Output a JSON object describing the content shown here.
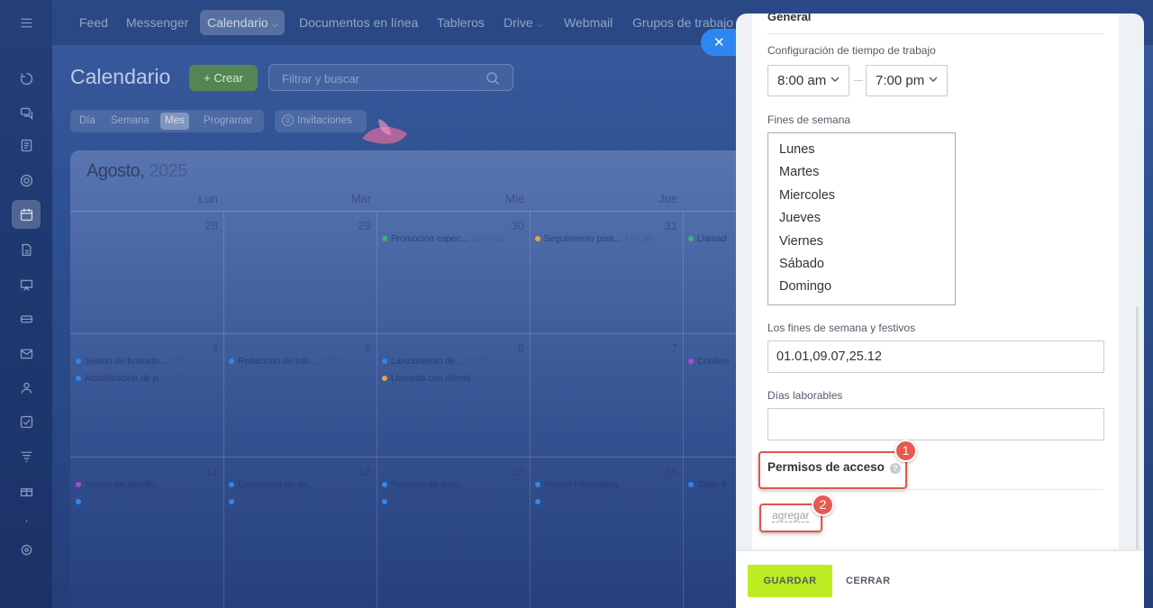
{
  "rail": {
    "icons": [
      "menu-icon",
      "sync-icon",
      "chat-icon",
      "doc-list-icon",
      "target-icon",
      "calendar-icon",
      "document-icon",
      "board-icon",
      "drive-icon",
      "mail-icon",
      "contacts-icon",
      "tasks-icon",
      "filter-icon",
      "gifts-icon",
      "more-icon",
      "settings-icon"
    ]
  },
  "topnav": {
    "items": [
      "Feed",
      "Messenger",
      "Calendario",
      "Documentos en línea",
      "Tableros",
      "Drive",
      "Webmail",
      "Grupos de trabajo"
    ],
    "active": "Calendario"
  },
  "calendar": {
    "title": "Calendario",
    "create_label": "+ Crear",
    "search_placeholder": "Filtrar y buscar",
    "views": [
      "Día",
      "Semana",
      "Mes",
      "Programar"
    ],
    "active_view": "Mes",
    "invitations_count": "0",
    "invitations_label": "Invitaciones",
    "month": "Agosto,",
    "year": "2025",
    "weekdays": [
      "Lun",
      "Mar",
      "Mié",
      "Jue"
    ],
    "weeks": [
      {
        "days": [
          "28",
          "29",
          "30",
          "31"
        ],
        "events": [
          {
            "col": 2,
            "row": 0,
            "title": "Promoción espec...",
            "time": "10:00 am",
            "color": "#3bb273"
          },
          {
            "col": 3,
            "row": 0,
            "title": "Seguimiento post...",
            "time": "4:00 pm",
            "color": "#e6a23c"
          },
          {
            "col": 4,
            "row": 0,
            "title": "Llamad",
            "time": "",
            "color": "#3bb273"
          }
        ]
      },
      {
        "days": [
          "4",
          "5",
          "6",
          "7"
        ],
        "events": [
          {
            "col": 0,
            "row": 0,
            "title": "Sesión de brainsto...",
            "time": "1:30 pm",
            "color": "#2f86f0"
          },
          {
            "col": 0,
            "row": 1,
            "title": "Actualización de p...",
            "time": "3:00 pm",
            "color": "#2f86f0"
          },
          {
            "col": 1,
            "row": 0,
            "title": "Redacción de info...",
            "time": "2:00 pm",
            "color": "#2f86f0"
          },
          {
            "col": 2,
            "row": 0,
            "title": "Lanzamiento de ...",
            "time": "10:30 am",
            "color": "#2f86f0"
          },
          {
            "col": 2,
            "row": 1,
            "title": "Llamada con cliente",
            "time": "2:00 pm",
            "color": "#e6a23c"
          },
          {
            "col": 4,
            "row": 0,
            "title": "Confere",
            "time": "",
            "color": "#a84bd6"
          }
        ]
      },
      {
        "days": [
          "11",
          "12",
          "13",
          "14"
        ],
        "events": [
          {
            "col": 0,
            "row": 0,
            "title": "Sesión de planific...",
            "time": "3:00 pm",
            "color": "#a84bd6"
          },
          {
            "col": 0,
            "row": 1,
            "title": "Sesión informativa",
            "time": "10:30 pm",
            "color": "#2f86f0",
            "faded": true
          },
          {
            "col": 1,
            "row": 0,
            "title": "Evaluación de de...",
            "time": "11:00 am",
            "color": "#2f86f0"
          },
          {
            "col": 1,
            "row": 1,
            "title": "Evento de networ...",
            "time": "1:30 pm",
            "color": "#2f86f0",
            "faded": true
          },
          {
            "col": 2,
            "row": 0,
            "title": "Revisión de docu...",
            "time": "11:00 am",
            "color": "#2f86f0"
          },
          {
            "col": 2,
            "row": 1,
            "title": "Llamada con cliente",
            "time": "1:00 pm",
            "color": "#2f86f0",
            "faded": true
          },
          {
            "col": 3,
            "row": 0,
            "title": "Sesión informativa",
            "time": "10:00 am",
            "color": "#2f86f0"
          },
          {
            "col": 3,
            "row": 1,
            "title": "Capacitación en ll...",
            "time": "11:00 am",
            "color": "#2f86f0",
            "faded": true
          },
          {
            "col": 4,
            "row": 0,
            "title": "Taller d",
            "time": "",
            "color": "#2f86f0"
          }
        ]
      }
    ]
  },
  "panel": {
    "close_icon": "close-icon",
    "section_title": "General",
    "work_time_label": "Configuración de tiempo de trabajo",
    "work_start": "8:00 am",
    "work_end": "7:00 pm",
    "weekends_label": "Fines de semana",
    "weekend_options": [
      "Lunes",
      "Martes",
      "Miercoles",
      "Jueves",
      "Viernes",
      "Sábado",
      "Domingo"
    ],
    "holidays_label": "Los fines de semana y festivos",
    "holidays_value": "01.01,09.07,25.12",
    "workdays_label": "Días laborables",
    "workdays_value": "",
    "access_label": "Permisos de acceso",
    "add_link": "agregar",
    "badge_1": "1",
    "badge_2": "2",
    "save_label": "GUARDAR",
    "close_label": "CERRAR",
    "highlight_color": "#e0554a",
    "save_color": "#bbed21"
  }
}
